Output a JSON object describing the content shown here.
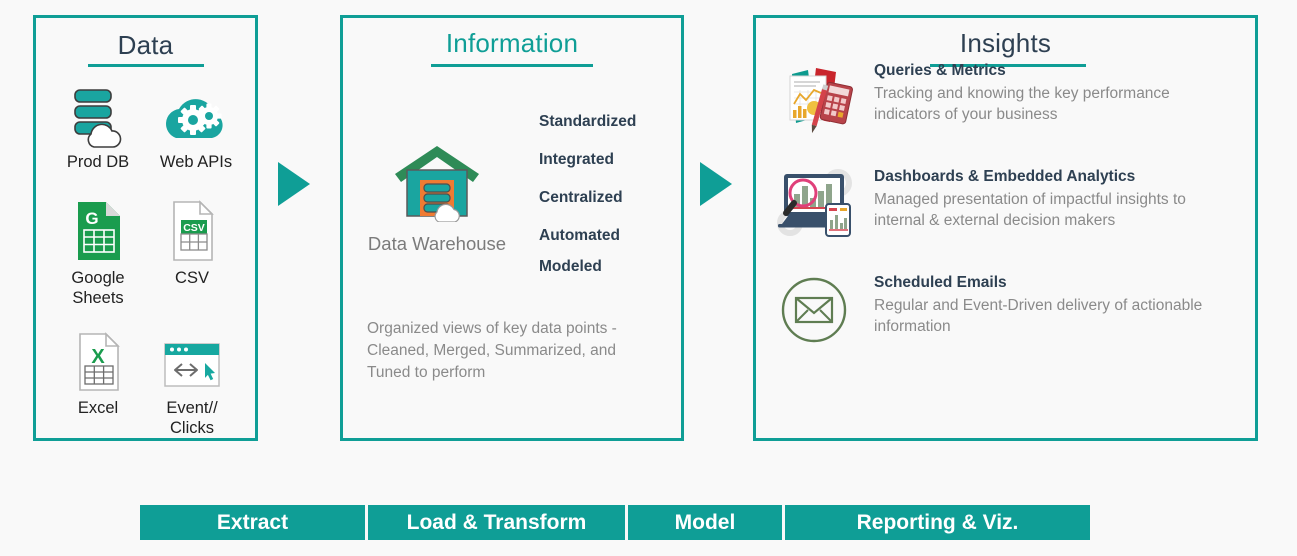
{
  "panels": {
    "data": {
      "title": "Data",
      "sources": [
        {
          "label": "Prod DB",
          "icon": "database-cloud-icon"
        },
        {
          "label": "Web APIs",
          "icon": "cloud-gears-icon"
        },
        {
          "label": "Google\nSheets",
          "label_line1": "Google",
          "label_line2": "Sheets",
          "icon": "google-sheets-icon"
        },
        {
          "label": "CSV",
          "icon": "csv-file-icon"
        },
        {
          "label": "Excel",
          "icon": "excel-file-icon"
        },
        {
          "label": "Event//\nClicks",
          "label_line1": "Event//",
          "label_line2": "Clicks",
          "icon": "browser-events-icon"
        }
      ]
    },
    "information": {
      "title": "Information",
      "warehouse_label": "Data Warehouse",
      "warehouse_icon": "data-warehouse-icon",
      "attributes": [
        "Standardized",
        "Integrated",
        "Centralized",
        "Automated",
        "Modeled"
      ],
      "description": "Organized views of key data points - Cleaned, Merged, Summarized, and Tuned to perform"
    },
    "insights": {
      "title": "Insights",
      "items": [
        {
          "heading": "Queries & Metrics",
          "body": "Tracking and knowing the key performance indicators of your business",
          "icon": "report-calculator-icon"
        },
        {
          "heading": "Dashboards & Embedded Analytics",
          "body": "Managed presentation of impactful insights to internal & external decision makers",
          "icon": "dashboard-monitor-icon"
        },
        {
          "heading": "Scheduled Emails",
          "body": "Regular and Event-Driven delivery of actionable information",
          "icon": "envelope-circle-icon"
        }
      ]
    }
  },
  "arrows": [
    {
      "name": "arrow-data-to-information"
    },
    {
      "name": "arrow-information-to-insights"
    }
  ],
  "process_bars": [
    {
      "label": "Extract"
    },
    {
      "label": "Load & Transform"
    },
    {
      "label": "Model"
    },
    {
      "label": "Reporting & Viz."
    }
  ],
  "colors": {
    "teal": "#0f9e96",
    "navy": "#2e4052",
    "gray_text": "#8a8a8a",
    "background": "#f9f9f9",
    "green": "#1a9c4e",
    "orange": "#ef7b33",
    "red": "#c9252c"
  }
}
